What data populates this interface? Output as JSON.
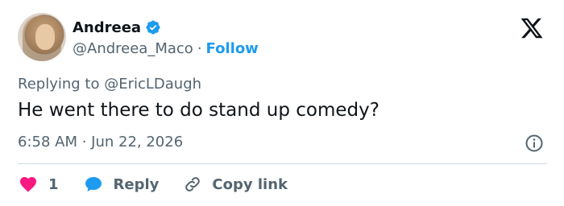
{
  "author": {
    "display_name": "Andreea",
    "handle": "@Andreea_Maco",
    "separator": "·",
    "follow_label": "Follow",
    "verified": true
  },
  "tweet": {
    "replying_to": "Replying to @EricLDaugh",
    "text": "He went there to do stand up comedy?",
    "timestamp": "6:58 AM · Jun 22, 2026"
  },
  "actions": {
    "like_count": "1",
    "reply_label": "Reply",
    "copy_link_label": "Copy link"
  },
  "icons": {
    "logo": "x-logo-icon",
    "verified": "verified-badge-icon",
    "info": "info-icon",
    "like": "heart-icon",
    "reply": "reply-bubble-icon",
    "copy": "link-icon"
  },
  "colors": {
    "accent": "#1d9bf0",
    "like": "#f91880",
    "muted_text": "#536471",
    "primary_text": "#0f1419",
    "divider": "#cfd9de"
  }
}
